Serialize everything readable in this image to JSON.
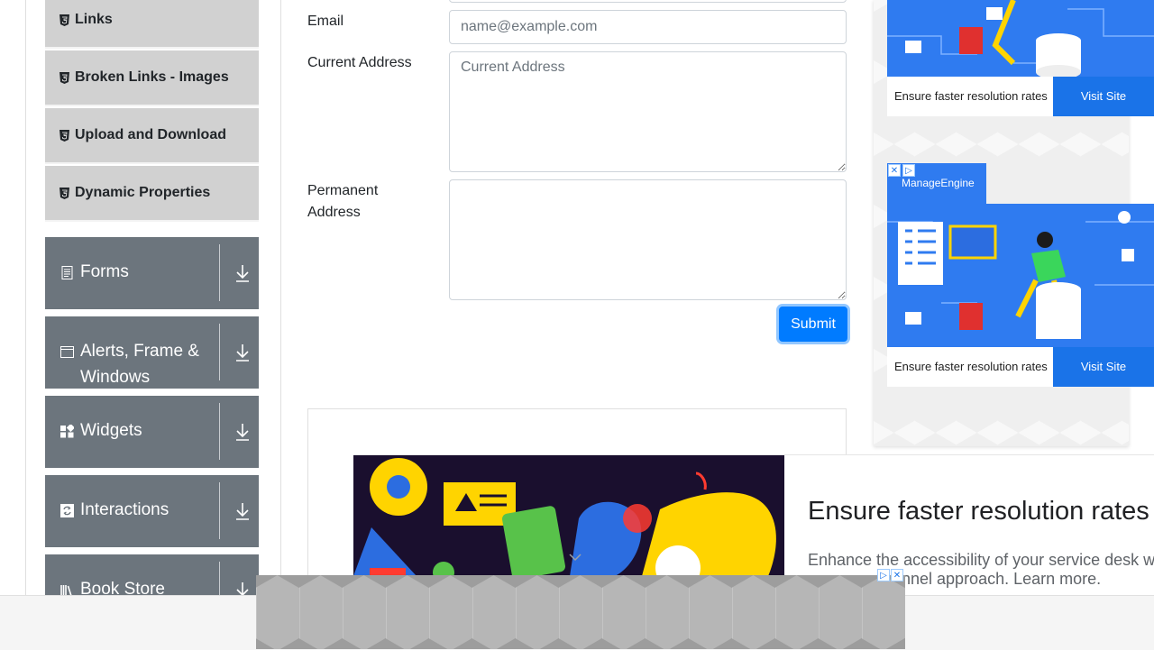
{
  "sidebar": {
    "items": [
      {
        "label": "Links",
        "icon": "html5-icon"
      },
      {
        "label": "Broken Links - Images",
        "icon": "html5-icon"
      },
      {
        "label": "Upload and Download",
        "icon": "html5-icon"
      },
      {
        "label": "Dynamic Properties",
        "icon": "html5-icon"
      }
    ],
    "groups": [
      {
        "label": "Forms",
        "icon": "document-icon"
      },
      {
        "label": "Alerts, Frame & Windows",
        "icon": "window-icon"
      },
      {
        "label": "Widgets",
        "icon": "widgets-icon"
      },
      {
        "label": "Interactions",
        "icon": "interactions-icon"
      },
      {
        "label": "Book Store",
        "icon": "books-icon"
      }
    ]
  },
  "form": {
    "email": {
      "label": "Email",
      "placeholder": "name@example.com",
      "value": ""
    },
    "current_address": {
      "label": "Current Address",
      "placeholder": "Current Address",
      "value": ""
    },
    "permanent_address": {
      "label": "Permanent Address",
      "value": ""
    },
    "submit_label": "Submit"
  },
  "ads": {
    "side": [
      {
        "text": "Ensure faster resolution rates",
        "button": "Visit Site"
      },
      {
        "text": "Ensure faster resolution rates",
        "button": "Visit Site"
      }
    ],
    "brand": "ManageEngine",
    "bottom": {
      "title": "Ensure faster resolution rates",
      "desc_line1": "Enhance the accessibility of your service desk w",
      "desc_line2": "nnel approach. Learn more."
    }
  },
  "colors": {
    "primary": "#007bff",
    "sidebar_group": "#6c757d",
    "sidebar_item": "#d1d1d1",
    "ad_blue": "#2f7bf0"
  }
}
